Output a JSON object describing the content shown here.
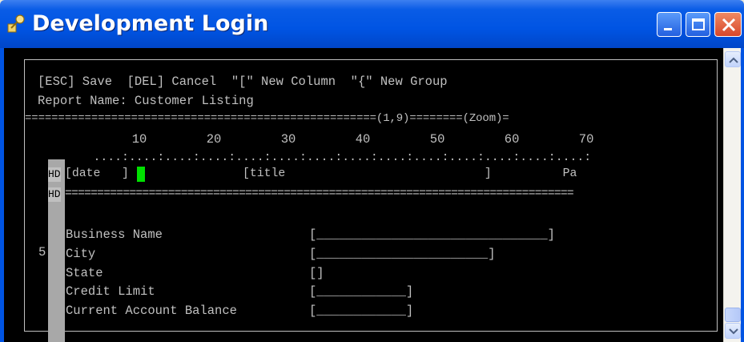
{
  "window": {
    "title": "Development Login",
    "icon": "key-icon",
    "buttons": {
      "minimize": "minimize-icon",
      "maximize": "maximize-icon",
      "close": "close-icon"
    }
  },
  "editor": {
    "help_line": "[ESC] Save  [DEL] Cancel  \"[\" New Column  \"{\" New Group",
    "report_name_line": "Report Name: Customer Listing",
    "ruler_status": "=====================================================(1,9)========(Zoom)=",
    "ruler_numbers": "         10        20        30        40        50        60        70",
    "ruler_dots": "    ....:....:....:....:....:....:....:....:....:....:....:....:....:....:",
    "header_band_label": "HD",
    "header_row": "[date   ]                [title                            ]          Pa",
    "header_sep_label": "HD",
    "header_sep": "===============================================================================",
    "row_number": "5",
    "fields": [
      {
        "label": "Business Name",
        "input": "[_______________________________]"
      },
      {
        "label": "City",
        "input": "[_______________________]"
      },
      {
        "label": "State",
        "input": "[]"
      },
      {
        "label": "Credit Limit",
        "input": "[____________]"
      },
      {
        "label": "Current Account Balance",
        "input": "[____________]"
      }
    ],
    "colors": {
      "cursor": "#00e000",
      "text": "#c0c0c0",
      "background": "#000000"
    }
  },
  "scrollbar": {
    "up": "scroll-up-icon",
    "down": "scroll-down-icon"
  }
}
